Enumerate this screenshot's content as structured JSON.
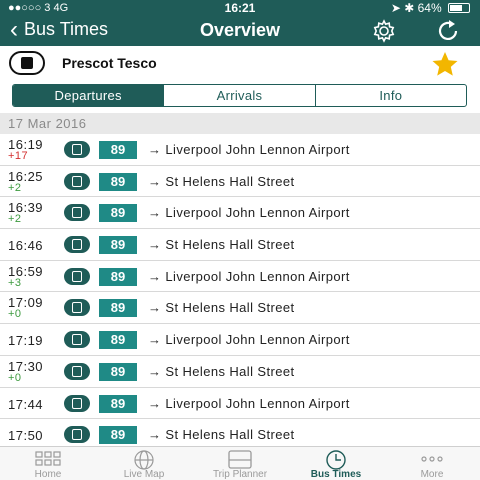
{
  "status_bar": {
    "signal": "●●○○○ 3   4G",
    "time": "16:21",
    "battery": "64%",
    "battery_level": 0.64
  },
  "nav": {
    "back_label": "Bus Times",
    "title": "Overview"
  },
  "stop": {
    "name": "Prescot Tesco",
    "favorite": true
  },
  "segments": {
    "items": [
      "Departures",
      "Arrivals",
      "Info"
    ],
    "active": "Departures"
  },
  "date": "17 Mar 2016",
  "departures": [
    {
      "time": "16:19",
      "delay": "+17",
      "route": "89",
      "destination": "Liverpool John Lennon Airport"
    },
    {
      "time": "16:25",
      "delay": "+2",
      "route": "89",
      "destination": "St Helens Hall Street"
    },
    {
      "time": "16:39",
      "delay": "+2",
      "route": "89",
      "destination": "Liverpool John Lennon Airport"
    },
    {
      "time": "16:46",
      "delay": "",
      "route": "89",
      "destination": "St Helens Hall Street"
    },
    {
      "time": "16:59",
      "delay": "+3",
      "route": "89",
      "destination": "Liverpool John Lennon Airport"
    },
    {
      "time": "17:09",
      "delay": "+0",
      "route": "89",
      "destination": "St Helens Hall Street"
    },
    {
      "time": "17:19",
      "delay": "",
      "route": "89",
      "destination": "Liverpool John Lennon Airport"
    },
    {
      "time": "17:30",
      "delay": "+0",
      "route": "89",
      "destination": "St Helens Hall Street"
    },
    {
      "time": "17:44",
      "delay": "",
      "route": "89",
      "destination": "Liverpool John Lennon Airport"
    },
    {
      "time": "17:50",
      "delay": "",
      "route": "89",
      "destination": "St Helens Hall Street"
    }
  ],
  "tabbar": {
    "items": [
      {
        "label": "Home",
        "icon": "grid-icon"
      },
      {
        "label": "Live Map",
        "icon": "globe-icon"
      },
      {
        "label": "Trip Planner",
        "icon": "bus-icon"
      },
      {
        "label": "Bus Times",
        "icon": "clock-icon"
      },
      {
        "label": "More",
        "icon": "more-icon"
      }
    ],
    "active": "Bus Times"
  },
  "colors": {
    "brand": "#1f5c58",
    "route_badge": "#1f8a86",
    "late": "#d32f2f",
    "on_time": "#3d9a3f",
    "favorite_star": "#f2b600"
  }
}
